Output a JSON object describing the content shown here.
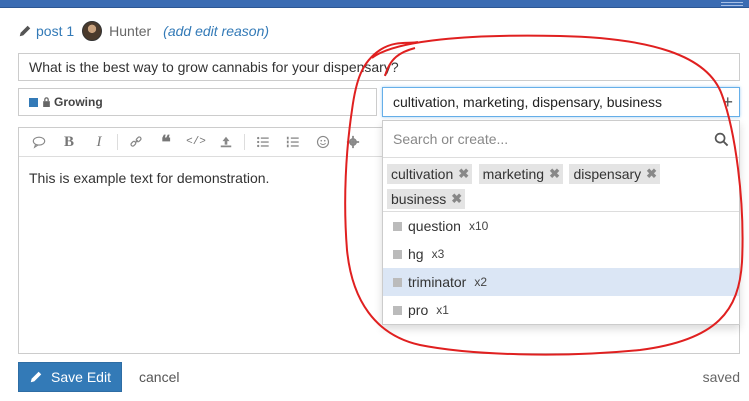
{
  "header": {
    "post_label": "post 1",
    "author": "Hunter",
    "edit_reason": "(add edit reason)"
  },
  "form": {
    "title_value": "What is the best way to grow cannabis for your dispensary?",
    "category": {
      "label": "Growing",
      "color": "#337ab7"
    },
    "tags_value": "cultivation, marketing, dispensary, business"
  },
  "editor": {
    "body_text": "This is example text for demonstration.",
    "toolbar": [
      "comment-icon",
      "bold-icon",
      "italic-icon",
      "link-icon",
      "quote-icon",
      "code-icon",
      "upload-icon",
      "bullet-list-icon",
      "numbered-list-icon",
      "emoji-icon",
      "gear-icon"
    ]
  },
  "tag_dropdown": {
    "search_placeholder": "Search or create...",
    "selected": [
      "cultivation",
      "marketing",
      "dispensary",
      "business"
    ],
    "options": [
      {
        "name": "question",
        "count": "x10"
      },
      {
        "name": "hg",
        "count": "x3"
      },
      {
        "name": "triminator",
        "count": "x2"
      },
      {
        "name": "pro",
        "count": "x1"
      }
    ]
  },
  "actions": {
    "save_label": "Save Edit",
    "cancel_label": "cancel",
    "status": "saved"
  },
  "colors": {
    "accent": "#337ab7",
    "annotation": "#e02020"
  }
}
